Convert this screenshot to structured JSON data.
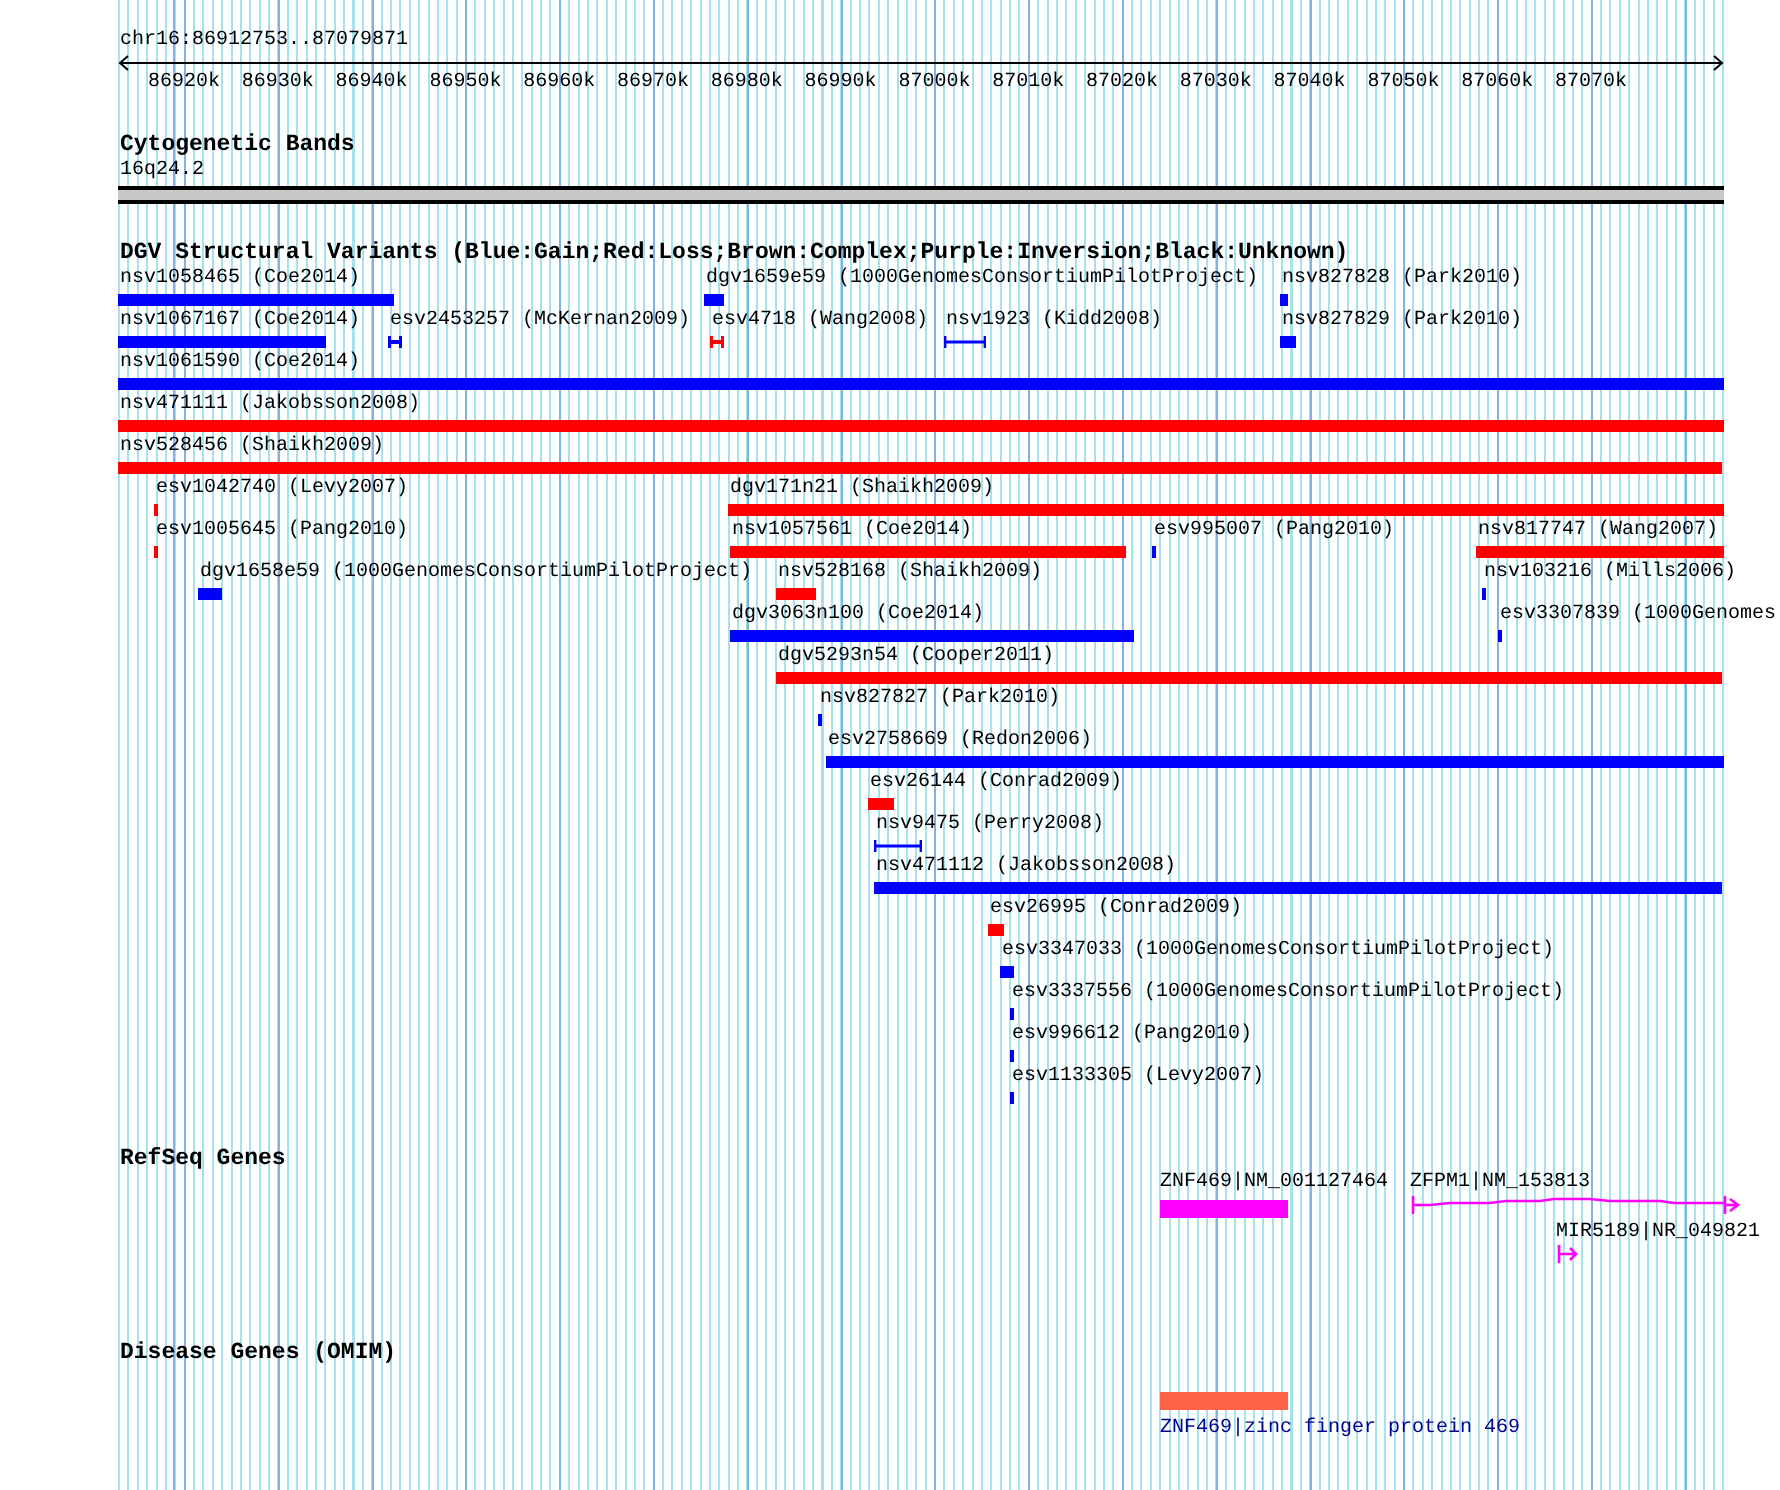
{
  "ruler": {
    "range": "chr16:86912753..87079871",
    "ticks": [
      "86920k",
      "86930k",
      "86940k",
      "86950k",
      "86960k",
      "86970k",
      "86980k",
      "86990k",
      "87000k",
      "87010k",
      "87020k",
      "87030k",
      "87040k",
      "87050k",
      "87060k",
      "87070k"
    ]
  },
  "tracks": [
    {
      "kind": "bands",
      "title": "Cytogenetic Bands",
      "label": "16q24.2"
    },
    {
      "kind": "variants",
      "title": "DGV Structural Variants (Blue:Gain;Red:Loss;Brown:Complex;Purple:Inversion;Black:Unknown)",
      "features": [
        {
          "label": "nsv1058465 (Coe2014)",
          "color": "#0000ff",
          "kind": "bar"
        },
        {
          "label": "dgv1659e59 (1000GenomesConsortiumPilotProject)",
          "color": "#0000ff",
          "kind": "bar"
        },
        {
          "label": "nsv827828 (Park2010)",
          "color": "#0000ff",
          "kind": "bar"
        },
        {
          "label": "nsv1067167 (Coe2014)",
          "color": "#0000ff",
          "kind": "bar"
        },
        {
          "label": "esv2453257 (McKernan2009)",
          "color": "#0000ff",
          "kind": "span"
        },
        {
          "label": "esv4718 (Wang2008)",
          "color": "#ff0000",
          "kind": "span"
        },
        {
          "label": "nsv1923 (Kidd2008)",
          "color": "#0000ff",
          "kind": "span"
        },
        {
          "label": "nsv827829 (Park2010)",
          "color": "#0000ff",
          "kind": "bar"
        },
        {
          "label": "nsv1061590 (Coe2014)",
          "color": "#0000ff",
          "kind": "bar"
        },
        {
          "label": "nsv471111 (Jakobsson2008)",
          "color": "#ff0000",
          "kind": "bar"
        },
        {
          "label": "nsv528456 (Shaikh2009)",
          "color": "#ff0000",
          "kind": "bar"
        },
        {
          "label": "esv1042740 (Levy2007)",
          "color": "#ff0000",
          "kind": "bar"
        },
        {
          "label": "dgv171n21 (Shaikh2009)",
          "color": "#ff0000",
          "kind": "bar"
        },
        {
          "label": "esv1005645 (Pang2010)",
          "color": "#ff0000",
          "kind": "bar"
        },
        {
          "label": "nsv1057561 (Coe2014)",
          "color": "#ff0000",
          "kind": "bar"
        },
        {
          "label": "esv995007 (Pang2010)",
          "color": "#0000ff",
          "kind": "bar"
        },
        {
          "label": "nsv817747 (Wang2007)",
          "color": "#ff0000",
          "kind": "bar"
        },
        {
          "label": "dgv1658e59 (1000GenomesConsortiumPilotProject)",
          "color": "#0000ff",
          "kind": "bar"
        },
        {
          "label": "nsv528168 (Shaikh2009)",
          "color": "#ff0000",
          "kind": "bar"
        },
        {
          "label": "nsv103216 (Mills2006)",
          "color": "#0000ff",
          "kind": "bar"
        },
        {
          "label": "dgv3063n100 (Coe2014)",
          "color": "#0000ff",
          "kind": "bar"
        },
        {
          "label": "esv3307839 (1000Genomes",
          "color": "#0000ff",
          "kind": "bar"
        },
        {
          "label": "dgv5293n54 (Cooper2011)",
          "color": "#ff0000",
          "kind": "bar"
        },
        {
          "label": "nsv827827 (Park2010)",
          "color": "#0000ff",
          "kind": "bar"
        },
        {
          "label": "esv2758669 (Redon2006)",
          "color": "#0000ff",
          "kind": "bar"
        },
        {
          "label": "esv26144 (Conrad2009)",
          "color": "#ff0000",
          "kind": "bar"
        },
        {
          "label": "nsv9475 (Perry2008)",
          "color": "#0000ff",
          "kind": "span"
        },
        {
          "label": "nsv471112 (Jakobsson2008)",
          "color": "#0000ff",
          "kind": "bar"
        },
        {
          "label": "esv26995 (Conrad2009)",
          "color": "#ff0000",
          "kind": "bar"
        },
        {
          "label": "esv3347033 (1000GenomesConsortiumPilotProject)",
          "color": "#0000ff",
          "kind": "bar"
        },
        {
          "label": "esv3337556 (1000GenomesConsortiumPilotProject)",
          "color": "#0000ff",
          "kind": "bar"
        },
        {
          "label": "esv996612 (Pang2010)",
          "color": "#0000ff",
          "kind": "bar"
        },
        {
          "label": "esv1133305 (Levy2007)",
          "color": "#0000ff",
          "kind": "bar"
        }
      ]
    },
    {
      "kind": "genes",
      "title": "RefSeq Genes",
      "features": [
        {
          "label": "ZNF469|NM_001127464",
          "kind": "block"
        },
        {
          "label": "ZFPM1|NM_153813",
          "kind": "transcript"
        },
        {
          "label": "MIR5189|NR_049821",
          "kind": "arrow"
        }
      ]
    },
    {
      "kind": "disease",
      "title": "Disease Genes (OMIM)",
      "features": [
        {
          "label": "ZNF469|zinc finger protein 469"
        }
      ]
    }
  ]
}
